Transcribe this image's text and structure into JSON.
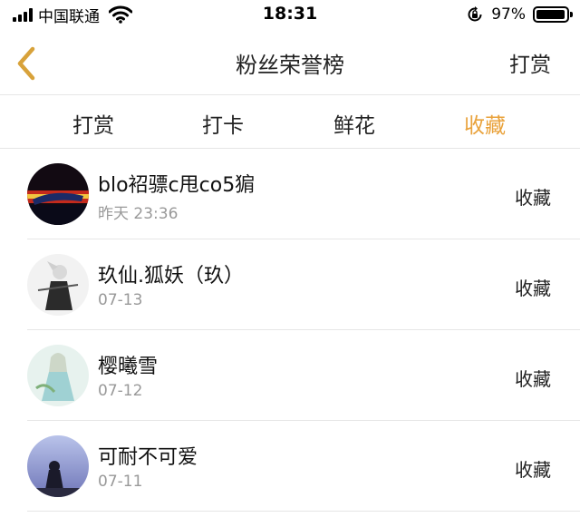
{
  "status_bar": {
    "carrier": "中国联通",
    "time": "18:31",
    "battery_percent": "97%",
    "battery_level": 0.97,
    "icons": [
      "signal-icon",
      "wifi-icon",
      "rotation-lock-icon",
      "battery-icon"
    ]
  },
  "nav": {
    "back_icon": "chevron-left-icon",
    "back_color": "#d8a23a",
    "title": "粉丝荣誉榜",
    "right_action": "打赏"
  },
  "tabs": {
    "items": [
      {
        "label": "打赏"
      },
      {
        "label": "打卡"
      },
      {
        "label": "鲜花"
      },
      {
        "label": "收藏"
      }
    ],
    "active_index": 3,
    "active_color": "#e9a23b"
  },
  "list": {
    "items": [
      {
        "name": "blo袑骠c甩co5猏",
        "time": "昨天 23:36",
        "action": "收藏"
      },
      {
        "name": "玖仙.狐妖（玖）",
        "time": "07-13",
        "action": "收藏"
      },
      {
        "name": "樱曦雪",
        "time": "07-12",
        "action": "收藏"
      },
      {
        "name": "可耐不可爱",
        "time": "07-11",
        "action": "收藏"
      }
    ]
  }
}
